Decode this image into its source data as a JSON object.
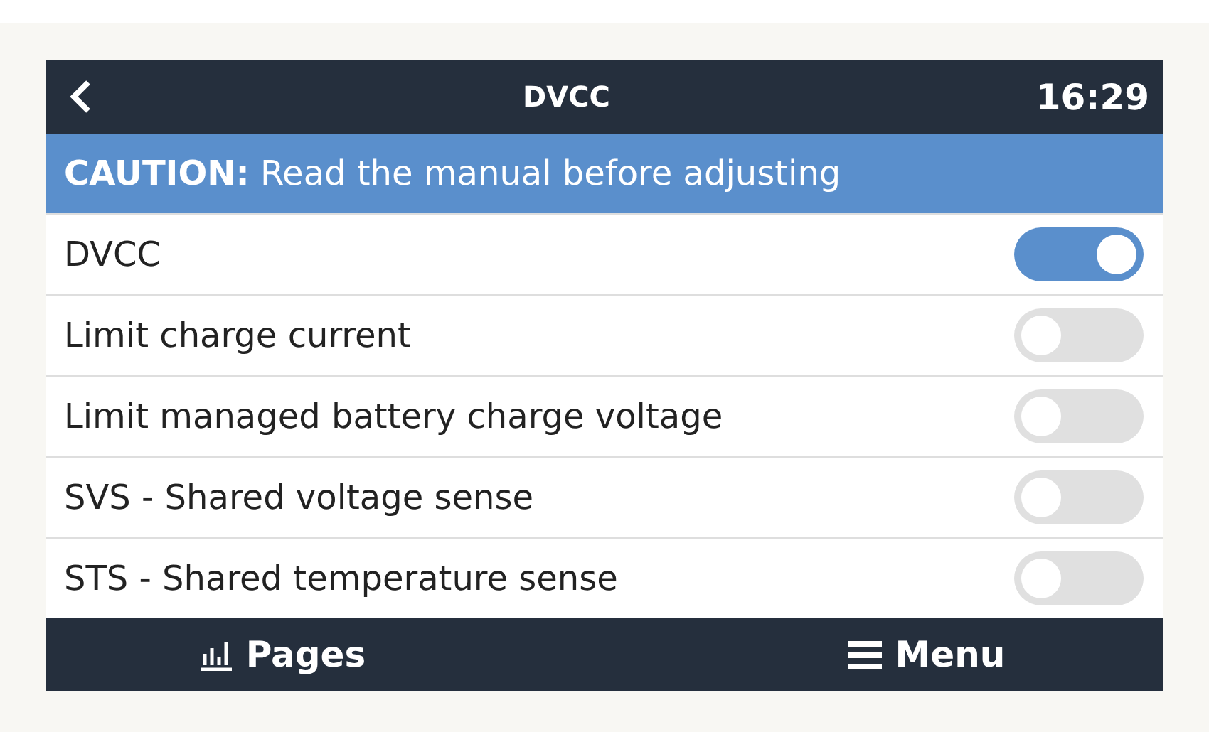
{
  "header": {
    "title": "DVCC",
    "time": "16:29"
  },
  "caution": "**CAUTION:** Read the manual before adjusting",
  "settings": [
    {
      "label": "DVCC",
      "on": true
    },
    {
      "label": "Limit charge current",
      "on": false
    },
    {
      "label": "Limit managed battery charge voltage",
      "on": false
    },
    {
      "label": "SVS - Shared voltage sense",
      "on": false
    },
    {
      "label": "STS - Shared temperature sense",
      "on": false
    }
  ],
  "footer": {
    "pages": "Pages",
    "menu": "Menu"
  }
}
